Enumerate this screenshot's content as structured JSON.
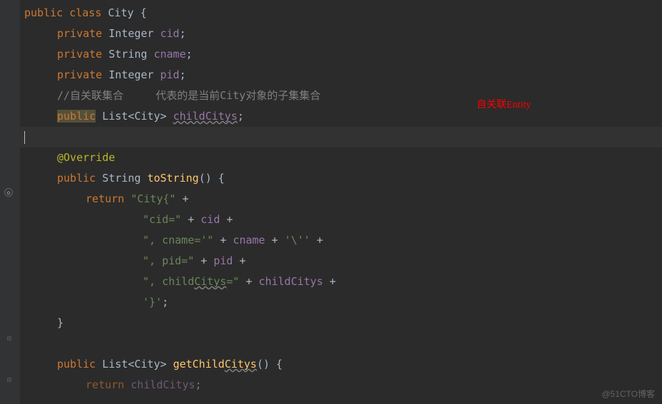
{
  "code": {
    "l1_kw1": "public",
    "l1_kw2": "class",
    "l1_name": "City",
    "l1_brace": "{",
    "l2_kw": "private",
    "l2_type": "Integer",
    "l2_field": "cid",
    "l3_kw": "private",
    "l3_type": "String",
    "l3_field": "cname",
    "l4_kw": "private",
    "l4_type": "Integer",
    "l4_field": "pid",
    "l5_comment": "//自关联集合     代表的是当前City对象的子集集合",
    "l6_kw": "public",
    "l6_type1": "List<",
    "l6_type2": "City",
    "l6_type3": ">",
    "l6_field": "childCitys",
    "l8_anno": "@Override",
    "l9_kw": "public",
    "l9_type": "String",
    "l9_method": "toString",
    "l9_sig": "() {",
    "l10_kw": "return",
    "l10_str": "\"City{\"",
    "l10_op": " +",
    "l11_str": "\"cid=\"",
    "l11_op": " + ",
    "l11_field": "cid",
    "l11_op2": " +",
    "l12_str": "\", cname='\"",
    "l12_op": " + ",
    "l12_field": "cname",
    "l12_op2": " + ",
    "l12_str2": "'\\''",
    "l12_op3": " +",
    "l13_str": "\", pid=\"",
    "l13_op": " + ",
    "l13_field": "pid",
    "l13_op2": " +",
    "l14_str": "\", child",
    "l14_str_wavy": "Citys",
    "l14_str2": "=\"",
    "l14_op": " + ",
    "l14_field": "childCitys",
    "l14_op2": " +",
    "l15_str": "'}'",
    "l15_end": ";",
    "l16_brace": "}",
    "l18_kw": "public",
    "l18_type1": "List<",
    "l18_type2": "City",
    "l18_type3": ">",
    "l18_method": "getChild",
    "l18_method_wavy": "Citys",
    "l18_sig": "() {",
    "l19_kw": "return",
    "l19_field": "childCitys"
  },
  "annotation": {
    "red_note": "自关联Entity"
  },
  "watermark": "@51CTO博客"
}
